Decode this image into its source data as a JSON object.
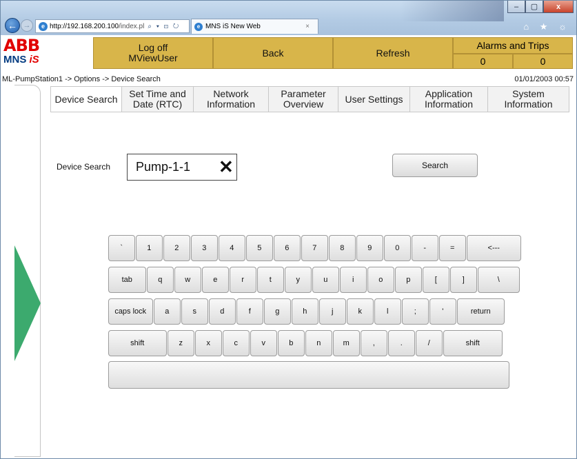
{
  "browser": {
    "url_host": "http://192.168.200.100",
    "url_rest": "/index.pl",
    "url_controls": "⌕ ▾ ⊡ ↻",
    "tab_title": "MNS iS New Web",
    "tab_close": "×",
    "back_glyph": "←",
    "forward_glyph": "→",
    "window_controls": [
      "–",
      "▢",
      "x"
    ],
    "toolbar_icons": "⌂ ★ ☼"
  },
  "header": {
    "logo_abb": "ABB",
    "logo_mns": "MNS ",
    "logo_is": "iS",
    "logoff_line1": "Log off",
    "logoff_line2": "MViewUser",
    "back_label": "Back",
    "refresh_label": "Refresh",
    "alarms_title": "Alarms and Trips",
    "alarms_count": "0",
    "trips_count": "0"
  },
  "breadcrumb": "ML-PumpStation1 -> Options -> Device Search",
  "datetime": "01/01/2003 00:57",
  "tabs": [
    {
      "label": "Device Search",
      "width": 104
    },
    {
      "label": "Set Time and\nDate (RTC)",
      "width": 104
    },
    {
      "label": "Network\nInformation",
      "width": 109
    },
    {
      "label": "Parameter\nOverview",
      "width": 101
    },
    {
      "label": "User Settings",
      "width": 104
    },
    {
      "label": "Application\nInformation",
      "width": 113
    },
    {
      "label": "System\nInformation",
      "width": 118
    }
  ],
  "search": {
    "label": "Device Search",
    "value": "Pump-1-1",
    "clear_glyph": "✕",
    "button_label": "Search"
  },
  "keyboard": {
    "rows": [
      [
        "`",
        "1",
        "2",
        "3",
        "4",
        "5",
        "6",
        "7",
        "8",
        "9",
        "0",
        "-",
        "=",
        "<---"
      ],
      [
        "tab",
        "q",
        "w",
        "e",
        "r",
        "t",
        "y",
        "u",
        "i",
        "o",
        "p",
        "[",
        "]",
        "\\"
      ],
      [
        "caps lock",
        "a",
        "s",
        "d",
        "f",
        "g",
        "h",
        "j",
        "k",
        "l",
        ";",
        "'",
        "return"
      ],
      [
        "shift",
        "z",
        "x",
        "c",
        "v",
        "b",
        "n",
        "m",
        ",",
        ".",
        "/",
        "shift"
      ]
    ]
  },
  "colors": {
    "header_button": "#d8b54a",
    "side_arrow": "#3caa6e",
    "abb_red": "#e10000"
  }
}
